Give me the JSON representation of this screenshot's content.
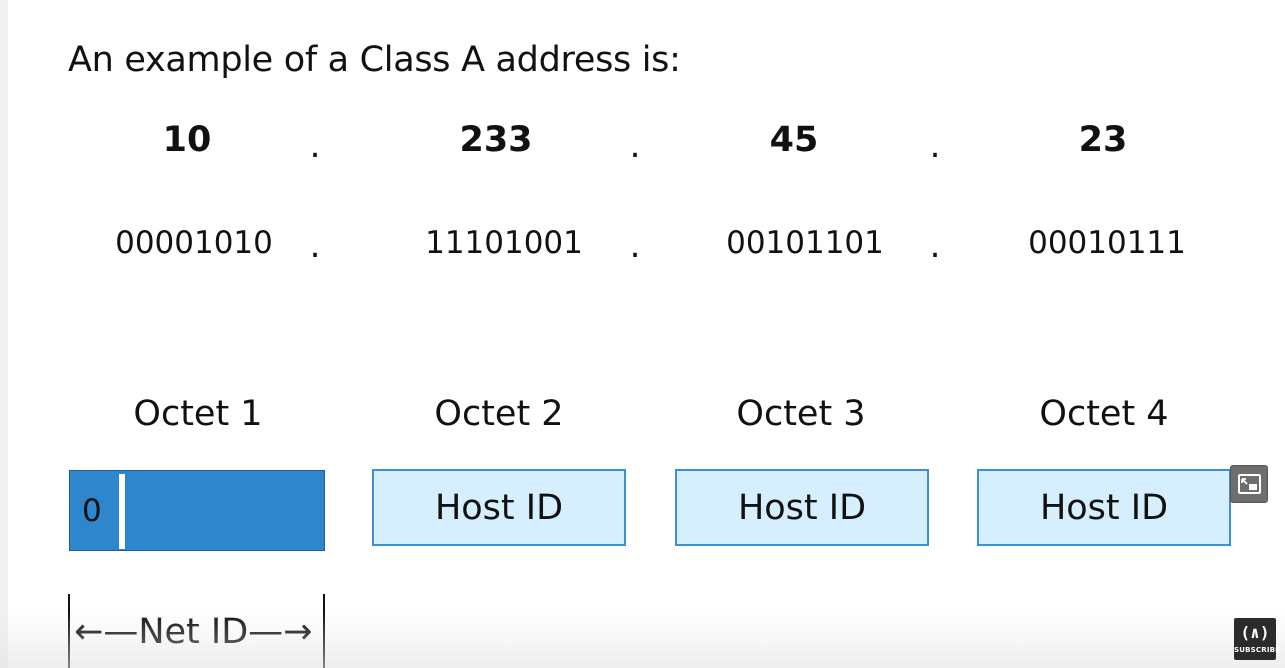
{
  "slide": {
    "heading": "An example of a Class A address is:",
    "separator": ".",
    "decimal_octets": [
      "10",
      "233",
      "45",
      "23"
    ],
    "binary_octets": [
      "00001010",
      "11101001",
      "00101101",
      "00010111"
    ],
    "octet_labels": [
      "Octet 1",
      "Octet 2",
      "Octet 3",
      "Octet 4"
    ],
    "network_bit": "0",
    "host_labels": [
      "Host ID",
      "Host ID",
      "Host ID"
    ],
    "net_id_label": "←—Net ID—→"
  },
  "colors": {
    "net_fill": "#2e86cc",
    "host_fill": "#d6efff",
    "host_border": "#3d8fd6"
  },
  "overlay": {
    "pip_icon": "picture-in-picture-icon",
    "badge_logo": "(∧)",
    "badge_text": "SUBSCRIBE"
  }
}
